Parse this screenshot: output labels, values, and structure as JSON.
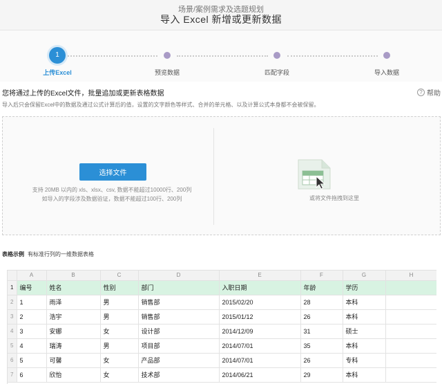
{
  "header": {
    "breadcrumb": "场景/案例需求及选题规划",
    "title": "导入 Excel 新增或更新数据"
  },
  "steps": [
    {
      "number": "1",
      "label": "上传Excel",
      "state": "active"
    },
    {
      "label": "预览数据",
      "state": "todo"
    },
    {
      "label": "匹配字段",
      "state": "todo"
    },
    {
      "label": "导入数据",
      "state": "todo"
    }
  ],
  "intro": {
    "title": "您将通过上传的Excel文件，批量追加或更新表格数据",
    "help_label": "帮助",
    "note": "导入后只会保留Excel中的数据及通过公式计算后的值，设置的文字颜色等样式、合并的单元格、以及计算公式本身都不会被保留。"
  },
  "upload": {
    "button_label": "选择文件",
    "hint_line1": "支持 20MB 以内的 xls、xlsx、csv, 数据不能超过10000行、200列",
    "hint_line2": "如导入的字段涉及数据验证，数据不能超过100行、200列",
    "drop_hint": "或将文件拖拽到这里",
    "drop_icon": "spreadsheet-file-icon"
  },
  "example": {
    "title": "表格示例",
    "subtitle": "有标准行列的一维数据表格"
  },
  "sheet": {
    "columns": [
      "",
      "A",
      "B",
      "C",
      "D",
      "E",
      "F",
      "G",
      "H"
    ],
    "header_row": {
      "num": "1",
      "cells": [
        "编号",
        "姓名",
        "性别",
        "部门",
        "入职日期",
        "年龄",
        "学历",
        ""
      ]
    },
    "rows": [
      {
        "num": "2",
        "cells": [
          "1",
          "雨泽",
          "男",
          "销售部",
          "2015/02/20",
          "28",
          "本科",
          ""
        ]
      },
      {
        "num": "3",
        "cells": [
          "2",
          "浩宇",
          "男",
          "销售部",
          "2015/01/12",
          "26",
          "本科",
          ""
        ]
      },
      {
        "num": "4",
        "cells": [
          "3",
          "安娜",
          "女",
          "设计部",
          "2014/12/09",
          "31",
          "硕士",
          ""
        ]
      },
      {
        "num": "5",
        "cells": [
          "4",
          "瑞涛",
          "男",
          "项目部",
          "2014/07/01",
          "35",
          "本科",
          ""
        ]
      },
      {
        "num": "6",
        "cells": [
          "5",
          "可馨",
          "女",
          "产品部",
          "2014/07/01",
          "26",
          "专科",
          ""
        ]
      },
      {
        "num": "7",
        "cells": [
          "6",
          "欣怡",
          "女",
          "技术部",
          "2014/06/21",
          "29",
          "本科",
          ""
        ]
      }
    ]
  },
  "colors": {
    "accent": "#2b8fd6",
    "todo_dot": "#a99bc6",
    "header_row_bg": "#d8f3e2"
  }
}
